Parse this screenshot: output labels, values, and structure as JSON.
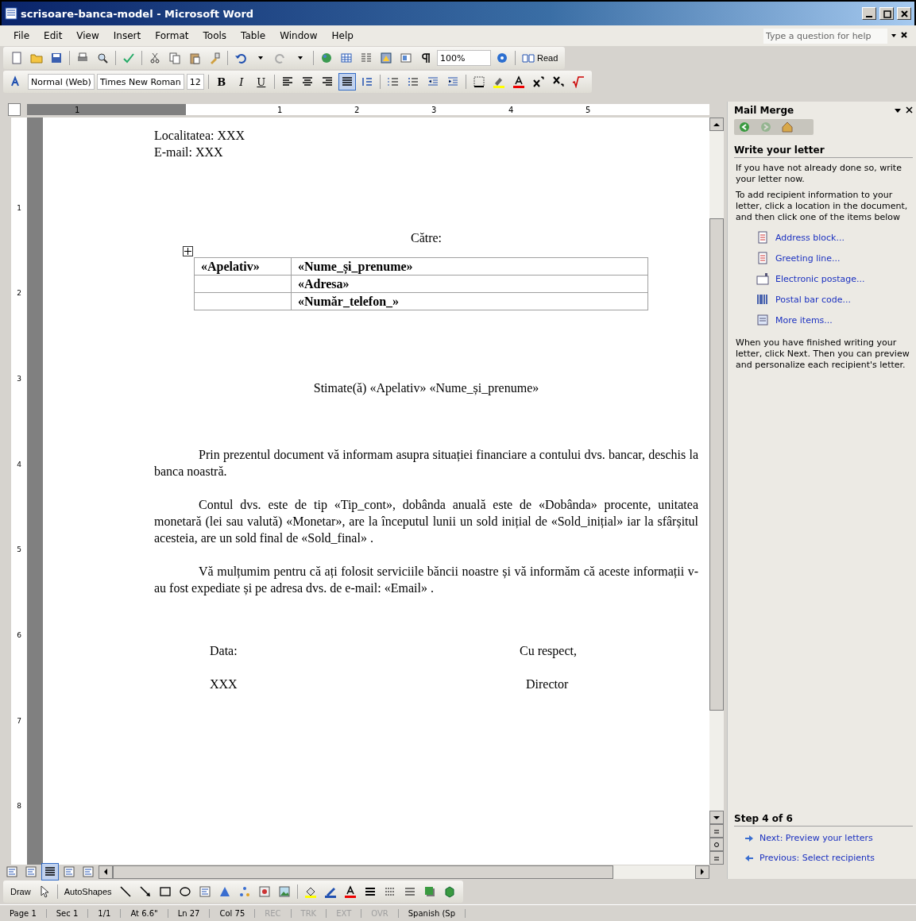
{
  "window": {
    "title": "scrisoare-banca-model - Microsoft Word"
  },
  "menu": [
    "File",
    "Edit",
    "View",
    "Insert",
    "Format",
    "Tools",
    "Table",
    "Window",
    "Help"
  ],
  "help_box": {
    "placeholder": "Type a question for help"
  },
  "standard_toolbar": {
    "zoom": "100%",
    "read": "Read"
  },
  "formatting_toolbar": {
    "style": "Normal (Web)",
    "font": "Times New Roman",
    "size": "12",
    "bold": "B",
    "italic": "I",
    "underline": "U",
    "alignment": [
      {
        "kind": "left",
        "selected": false
      },
      {
        "kind": "center",
        "selected": false
      },
      {
        "kind": "right",
        "selected": false
      },
      {
        "kind": "justify",
        "selected": true
      }
    ]
  },
  "ruler": {
    "numbers": [
      "1",
      "1",
      "2",
      "3",
      "4",
      "5"
    ]
  },
  "vertical_ruler": {
    "numbers": [
      "1",
      "2",
      "3",
      "4",
      "5",
      "6",
      "7",
      "8"
    ]
  },
  "document": {
    "lines": [
      "Localitatea: XXX",
      "E-mail: XXX"
    ],
    "recipient_label": "Către:",
    "table": {
      "rows": [
        {
          "column_1": "«Apelativ»",
          "column_2": "«Nume_și_prenume»"
        },
        {
          "column_2": "«Adresa»"
        },
        {
          "column_2": "«Număr_telefon_»"
        }
      ]
    },
    "greeting": "Stimate(ă) «Apelativ» «Nume_și_prenume»",
    "paragraphs": [
      "Prin prezentul document vă informam asupra situației financiare a contului dvs. bancar, deschis la banca noastră.",
      "Contul dvs. este de tip «Tip_cont», dobânda anuală este de «Dobânda» procente, unitatea monetară (lei sau valută) «Monetar», are la începutul lunii un sold inițial de «Sold_inițial» iar la sfârșitul acesteia, are un sold final de «Sold_final» .",
      "Vă mulțumim pentru că ați folosit serviciile băncii noastre și vă informăm că aceste informații v-au fost expediate și pe adresa dvs. de e-mail: «Email» ."
    ],
    "signature": {
      "left": [
        "Data:",
        "XXX"
      ],
      "right": [
        "Cu respect,",
        "Director"
      ]
    }
  },
  "task_pane": {
    "title": "Mail Merge",
    "nav": [
      {
        "kind": "back",
        "disabled": false
      },
      {
        "kind": "forward",
        "disabled": true
      },
      {
        "kind": "home",
        "disabled": false
      }
    ],
    "heading": "Write your letter",
    "intro": [
      "If you have not already done so, write your letter now.",
      "To add recipient information to your letter, click a location in the document, and then click one of the items below"
    ],
    "items": [
      {
        "kind": "document",
        "label": "Address block..."
      },
      {
        "kind": "document",
        "label": "Greeting line..."
      },
      {
        "kind": "postage",
        "label": "Electronic postage..."
      },
      {
        "kind": "barcode",
        "label": "Postal bar code..."
      },
      {
        "kind": "list",
        "label": "More items..."
      }
    ],
    "outro": "When you have finished writing your letter, click Next. Then you can preview and personalize each recipient's letter.",
    "step": "Step 4 of 6",
    "links": [
      {
        "kind": "next",
        "label": "Next: Preview your letters"
      },
      {
        "kind": "previous",
        "label": "Previous: Select recipients"
      }
    ]
  },
  "drawing_toolbar": {
    "draw": "Draw",
    "autoshapes": "AutoShapes"
  },
  "status_bar": [
    {
      "text": "Page 1",
      "disabled": false
    },
    {
      "text": "Sec 1",
      "disabled": false
    },
    {
      "text": "1/1",
      "disabled": false
    },
    {
      "text": "At 6.6\"",
      "disabled": false
    },
    {
      "text": "Ln 27",
      "disabled": false
    },
    {
      "text": "Col 75",
      "disabled": false
    },
    {
      "text": "REC",
      "disabled": true
    },
    {
      "text": "TRK",
      "disabled": true
    },
    {
      "text": "EXT",
      "disabled": true
    },
    {
      "text": "OVR",
      "disabled": true
    },
    {
      "text": "Spanish (Sp",
      "disabled": false
    }
  ]
}
